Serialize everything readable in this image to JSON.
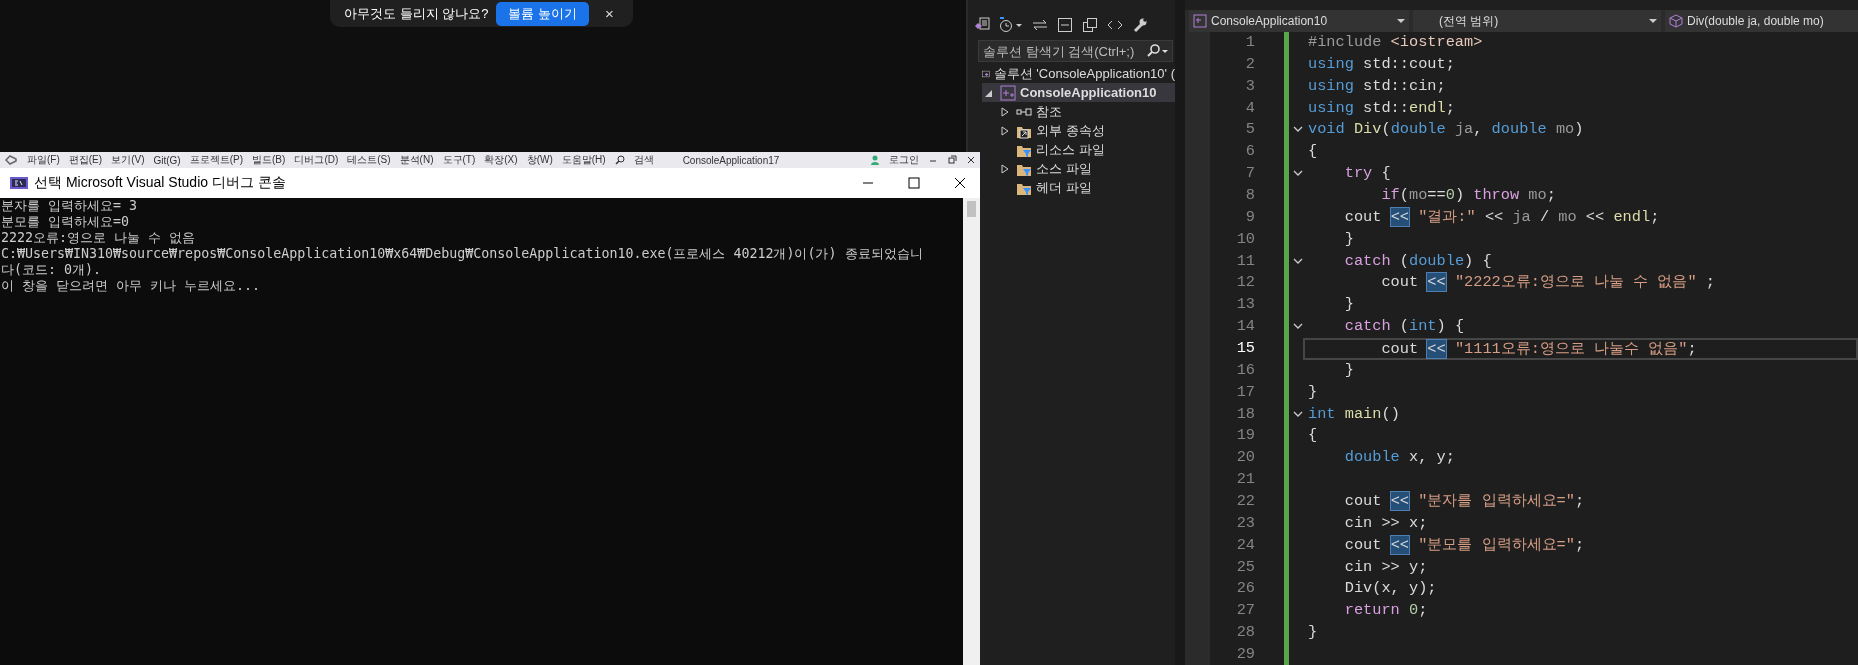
{
  "popup": {
    "message": "아무것도 들리지 않나요?",
    "button": "볼륨 높이기",
    "close": "×"
  },
  "vs_menu": {
    "items": [
      "파일(F)",
      "편집(E)",
      "보기(V)",
      "Git(G)",
      "프로젝트(P)",
      "빌드(B)",
      "디버그(D)",
      "테스트(S)",
      "분석(N)",
      "도구(T)",
      "확장(X)",
      "창(W)",
      "도움말(H)"
    ],
    "search": "검색",
    "solution": "ConsoleApplication17",
    "login": "로그인"
  },
  "console": {
    "title": "선택 Microsoft Visual Studio 디버그 콘솔",
    "lines": [
      "분자를 입력하세요= 3",
      "분모를 입력하세요=0",
      "2222오류:영으로 나눌 수 없음",
      "C:₩Users₩IN310₩source₩repos₩ConsoleApplication10₩x64₩Debug₩ConsoleApplication10.exe(프로세스 40212개)이(가) 종료되었습니",
      "다(코드: 0개).",
      "이 창을 닫으려면 아무 키나 누르세요..."
    ]
  },
  "explorer": {
    "search": {
      "placeholder": "솔루션 탐색기 검색(Ctrl+;)"
    },
    "tree": [
      {
        "label": "솔루션 'ConsoleApplication10' (",
        "kind": "solution",
        "selected": false,
        "expandable": false,
        "expanded": false,
        "children": [
          {
            "label": "ConsoleApplication10",
            "kind": "project",
            "selected": true,
            "expandable": true,
            "expanded": true,
            "children": [
              {
                "label": "참조",
                "kind": "references",
                "selected": false,
                "expandable": true,
                "expanded": false
              },
              {
                "label": "외부 종속성",
                "kind": "external",
                "selected": false,
                "expandable": true,
                "expanded": false
              },
              {
                "label": "리소스 파일",
                "kind": "filter",
                "selected": false,
                "expandable": false,
                "expanded": false
              },
              {
                "label": "소스 파일",
                "kind": "filter",
                "selected": false,
                "expandable": true,
                "expanded": false
              },
              {
                "label": "헤더 파일",
                "kind": "filter",
                "selected": false,
                "expandable": false,
                "expanded": false
              }
            ]
          }
        ]
      }
    ]
  },
  "editor": {
    "nav": {
      "project": "ConsoleApplication10",
      "scope": "(전역 범위)",
      "member": "Div(double ja, double mo)"
    },
    "lines": [
      {
        "n": "1",
        "fold": false,
        "current": false,
        "t": [
          {
            "kind": "preprocessor",
            "text": "#include"
          },
          {
            "kind": "header",
            "text": " <iostream>"
          }
        ]
      },
      {
        "n": "2",
        "fold": false,
        "current": false,
        "t": [
          {
            "kind": "keyword",
            "text": "using"
          },
          {
            "kind": "plain",
            "text": " std::cout;"
          }
        ]
      },
      {
        "n": "3",
        "fold": false,
        "current": false,
        "t": [
          {
            "kind": "keyword",
            "text": "using"
          },
          {
            "kind": "plain",
            "text": " std::cin;"
          }
        ]
      },
      {
        "n": "4",
        "fold": false,
        "current": false,
        "t": [
          {
            "kind": "keyword",
            "text": "using"
          },
          {
            "kind": "plain",
            "text": " std::"
          },
          {
            "kind": "function",
            "text": "endl"
          },
          {
            "kind": "plain",
            "text": ";"
          }
        ]
      },
      {
        "n": "5",
        "fold": true,
        "current": false,
        "t": [
          {
            "kind": "keyword",
            "text": "void"
          },
          {
            "kind": "function",
            "text": " Div"
          },
          {
            "kind": "plain",
            "text": "("
          },
          {
            "kind": "keyword",
            "text": "double"
          },
          {
            "kind": "parameter",
            "text": " ja"
          },
          {
            "kind": "plain",
            "text": ","
          },
          {
            "kind": "keyword",
            "text": " double"
          },
          {
            "kind": "parameter",
            "text": " mo"
          },
          {
            "kind": "plain",
            "text": ")"
          }
        ]
      },
      {
        "n": "6",
        "fold": false,
        "current": false,
        "t": [
          {
            "kind": "plain",
            "text": "{"
          }
        ]
      },
      {
        "n": "7",
        "fold": true,
        "current": false,
        "t": [
          {
            "kind": "control",
            "text": "    try"
          },
          {
            "kind": "plain",
            "text": " {"
          }
        ]
      },
      {
        "n": "8",
        "fold": false,
        "current": false,
        "t": [
          {
            "kind": "control",
            "text": "        if"
          },
          {
            "kind": "plain",
            "text": "("
          },
          {
            "kind": "parameter",
            "text": "mo"
          },
          {
            "kind": "plain",
            "text": "=="
          },
          {
            "kind": "number",
            "text": "0"
          },
          {
            "kind": "plain",
            "text": ")"
          },
          {
            "kind": "control",
            "text": " throw"
          },
          {
            "kind": "parameter",
            "text": " mo"
          },
          {
            "kind": "plain",
            "text": ";"
          }
        ]
      },
      {
        "n": "9",
        "fold": false,
        "current": false,
        "t": [
          {
            "kind": "plain",
            "text": "    cout "
          },
          {
            "kind": "match",
            "text": "<<"
          },
          {
            "kind": "string",
            "text": " \"결과:\""
          },
          {
            "kind": "plain",
            "text": " << "
          },
          {
            "kind": "parameter",
            "text": "ja"
          },
          {
            "kind": "plain",
            "text": " / "
          },
          {
            "kind": "parameter",
            "text": "mo"
          },
          {
            "kind": "plain",
            "text": " << "
          },
          {
            "kind": "function",
            "text": "endl"
          },
          {
            "kind": "plain",
            "text": ";"
          }
        ]
      },
      {
        "n": "10",
        "fold": false,
        "current": false,
        "t": [
          {
            "kind": "plain",
            "text": "    }"
          }
        ]
      },
      {
        "n": "11",
        "fold": true,
        "current": false,
        "t": [
          {
            "kind": "control",
            "text": "    catch"
          },
          {
            "kind": "plain",
            "text": " ("
          },
          {
            "kind": "keyword",
            "text": "double"
          },
          {
            "kind": "plain",
            "text": ") {"
          }
        ]
      },
      {
        "n": "12",
        "fold": false,
        "current": false,
        "t": [
          {
            "kind": "plain",
            "text": "        cout "
          },
          {
            "kind": "match",
            "text": "<<"
          },
          {
            "kind": "string",
            "text": " \"2222오류:영으로 나눌 수 없음\""
          },
          {
            "kind": "plain",
            "text": " ;"
          }
        ]
      },
      {
        "n": "13",
        "fold": false,
        "current": false,
        "t": [
          {
            "kind": "plain",
            "text": "    }"
          }
        ]
      },
      {
        "n": "14",
        "fold": true,
        "current": false,
        "t": [
          {
            "kind": "control",
            "text": "    catch"
          },
          {
            "kind": "plain",
            "text": " ("
          },
          {
            "kind": "keyword",
            "text": "int"
          },
          {
            "kind": "plain",
            "text": ") {"
          }
        ]
      },
      {
        "n": "15",
        "fold": false,
        "current": true,
        "t": [
          {
            "kind": "plain",
            "text": "        cout "
          },
          {
            "kind": "match",
            "text": "<<"
          },
          {
            "kind": "string",
            "text": " \"1111오류:영으로 나눌수 없음\""
          },
          {
            "kind": "plain",
            "text": ";"
          }
        ]
      },
      {
        "n": "16",
        "fold": false,
        "current": false,
        "t": [
          {
            "kind": "plain",
            "text": "    }"
          }
        ]
      },
      {
        "n": "17",
        "fold": false,
        "current": false,
        "t": [
          {
            "kind": "plain",
            "text": "}"
          }
        ]
      },
      {
        "n": "18",
        "fold": true,
        "current": false,
        "t": [
          {
            "kind": "keyword",
            "text": "int"
          },
          {
            "kind": "function",
            "text": " main"
          },
          {
            "kind": "plain",
            "text": "()"
          }
        ]
      },
      {
        "n": "19",
        "fold": false,
        "current": false,
        "t": [
          {
            "kind": "plain",
            "text": "{"
          }
        ]
      },
      {
        "n": "20",
        "fold": false,
        "current": false,
        "t": [
          {
            "kind": "keyword",
            "text": "    double"
          },
          {
            "kind": "plain",
            "text": " x, y;"
          }
        ]
      },
      {
        "n": "21",
        "fold": false,
        "current": false
      },
      {
        "n": "22",
        "fold": false,
        "current": false,
        "t": [
          {
            "kind": "plain",
            "text": "    cout "
          },
          {
            "kind": "match",
            "text": "<<"
          },
          {
            "kind": "string",
            "text": " \"분자를 입력하세요=\""
          },
          {
            "kind": "plain",
            "text": ";"
          }
        ]
      },
      {
        "n": "23",
        "fold": false,
        "current": false,
        "t": [
          {
            "kind": "plain",
            "text": "    cin >> x;"
          }
        ]
      },
      {
        "n": "24",
        "fold": false,
        "current": false,
        "t": [
          {
            "kind": "plain",
            "text": "    cout "
          },
          {
            "kind": "match",
            "text": "<<"
          },
          {
            "kind": "string",
            "text": " \"분모를 입력하세요=\""
          },
          {
            "kind": "plain",
            "text": ";"
          }
        ]
      },
      {
        "n": "25",
        "fold": false,
        "current": false,
        "t": [
          {
            "kind": "plain",
            "text": "    cin >> y;"
          }
        ]
      },
      {
        "n": "26",
        "fold": false,
        "current": false,
        "t": [
          {
            "kind": "plain",
            "text": "    Div(x, y);"
          }
        ]
      },
      {
        "n": "27",
        "fold": false,
        "current": false,
        "t": [
          {
            "kind": "control",
            "text": "    return"
          },
          {
            "kind": "number",
            "text": " 0"
          },
          {
            "kind": "plain",
            "text": ";"
          }
        ]
      },
      {
        "n": "28",
        "fold": false,
        "current": false,
        "t": [
          {
            "kind": "plain",
            "text": "}"
          }
        ]
      },
      {
        "n": "29",
        "fold": false,
        "current": false
      }
    ]
  }
}
